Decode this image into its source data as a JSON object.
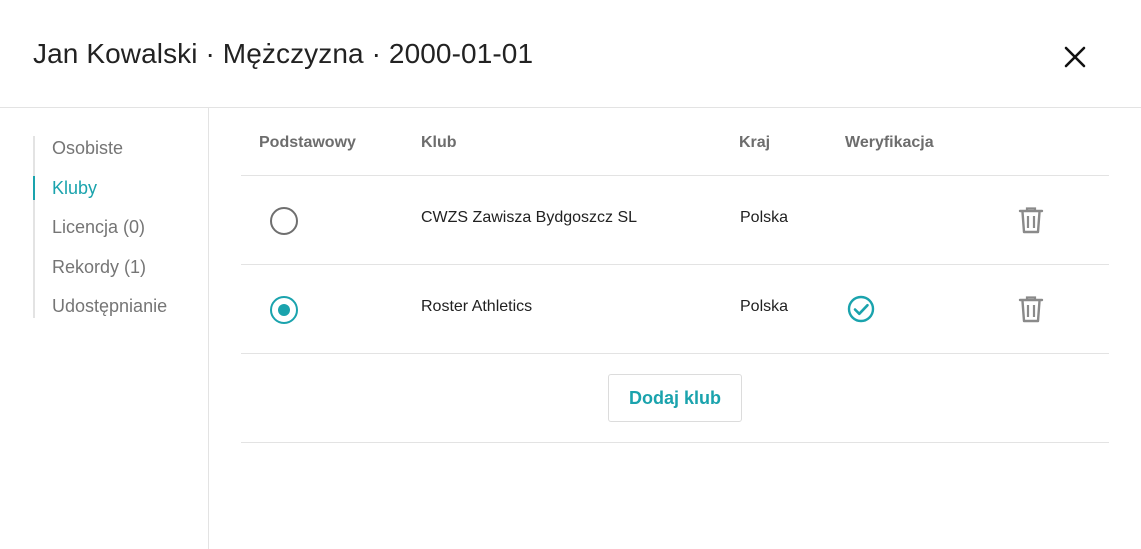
{
  "header": {
    "title": "Jan Kowalski · Mężczyzna · 2000-01-01",
    "close_icon": "close-icon"
  },
  "sidebar": {
    "items": [
      {
        "label": "Osobiste",
        "active": false
      },
      {
        "label": "Kluby",
        "active": true
      },
      {
        "label": "Licencja (0)",
        "active": false
      },
      {
        "label": "Rekordy (1)",
        "active": false
      },
      {
        "label": "Udostępnianie",
        "active": false
      }
    ]
  },
  "table": {
    "columns": [
      "Podstawowy",
      "Klub",
      "Kraj",
      "Weryfikacja"
    ],
    "rows": [
      {
        "primary": false,
        "club": "CWZS Zawisza Bydgoszcz SL",
        "country": "Polska",
        "verified": false
      },
      {
        "primary": true,
        "club": "Roster Athletics",
        "country": "Polska",
        "verified": true
      }
    ]
  },
  "add_button": {
    "label": "Dodaj klub"
  },
  "colors": {
    "accent": "#1aa3ad",
    "text": "#212121",
    "muted": "#757575",
    "border": "#e3e3e3"
  },
  "icons": {
    "verified": "check-circle-icon",
    "delete": "trash-icon",
    "radio": "radio-icon"
  }
}
